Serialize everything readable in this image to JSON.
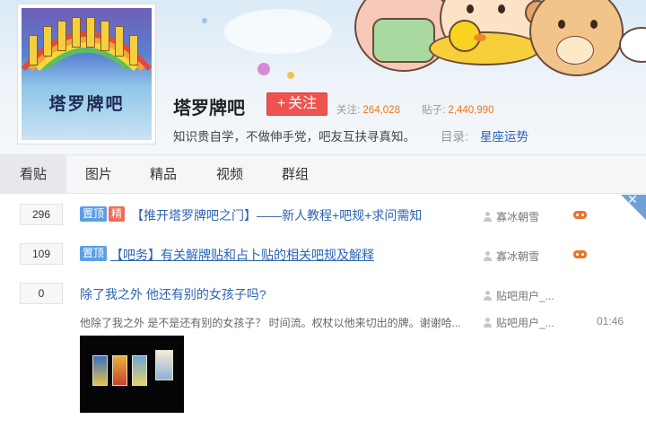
{
  "forum": {
    "avatar_text": "塔罗牌吧",
    "name": "塔罗牌吧",
    "follow_label": "关注",
    "follow_plus": "+",
    "followers_label": "关注:",
    "followers_value": "264,028",
    "posts_label": "贴子:",
    "posts_value": "2,440,990",
    "slogan": "知识贵自学，不做伸手党，吧友互扶寻真知。",
    "directory_label": "目录:",
    "directory_value": "星座运势"
  },
  "tabs": [
    {
      "label": "看贴",
      "active": true
    },
    {
      "label": "图片",
      "active": false
    },
    {
      "label": "精品",
      "active": false
    },
    {
      "label": "视频",
      "active": false
    },
    {
      "label": "群组",
      "active": false
    }
  ],
  "close_glyph": "✕",
  "threads": [
    {
      "replies": "296",
      "tag_top": "置顶",
      "tag_jing": "精",
      "title": "【推开塔罗牌吧之门】——新人教程+吧规+求问需知",
      "author": "寡冰朝雪"
    },
    {
      "replies": "109",
      "tag_top": "置顶",
      "title": "【吧务】有关解牌贴和占卜贴的相关吧规及解释",
      "author": "寡冰朝雪"
    },
    {
      "replies": "0",
      "title": "除了我之外 他还有别的女孩子吗?",
      "author": "贴吧用户_...",
      "excerpt": "他除了我之外 是不是还有别的女孩子？ 时间流。权杖以他来切出的牌。谢谢哈...",
      "last_replier": "贴吧用户_...",
      "time": "01:46"
    }
  ],
  "colors": {
    "accent_link": "#2d64b3",
    "follow_button": "#ef5350",
    "stat_number": "#e8791f",
    "tag_top": "#5b9ee6",
    "tag_jing": "#ef6b5a"
  }
}
